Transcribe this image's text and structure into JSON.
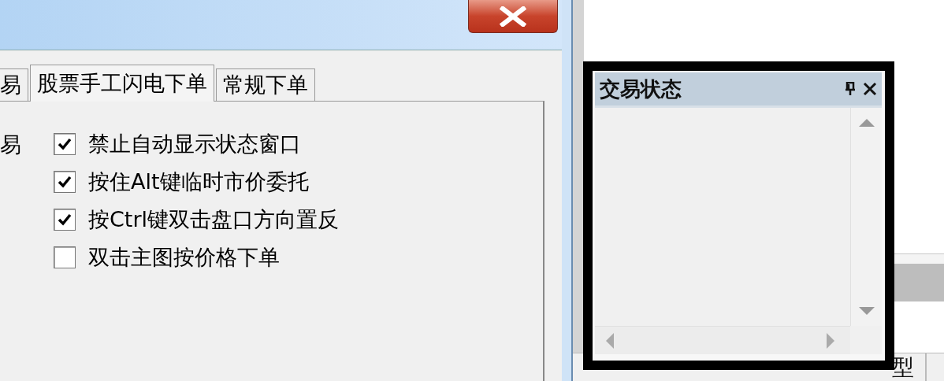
{
  "dialog": {
    "tabs": [
      {
        "label": "易",
        "selected": false
      },
      {
        "label": "股票手工闪电下单",
        "selected": true
      },
      {
        "label": "常规下单",
        "selected": false
      }
    ],
    "section_label": "易",
    "options": [
      {
        "label": "禁止自动显示状态窗口",
        "checked": true
      },
      {
        "label": "按住Alt键临时市价委托",
        "checked": true
      },
      {
        "label": "按Ctrl键双击盘口方向置反",
        "checked": true
      },
      {
        "label": "双击主图按价格下单",
        "checked": false
      }
    ]
  },
  "status_panel": {
    "title": "交易状态"
  },
  "background_table": {
    "columns": [
      "型"
    ]
  }
}
